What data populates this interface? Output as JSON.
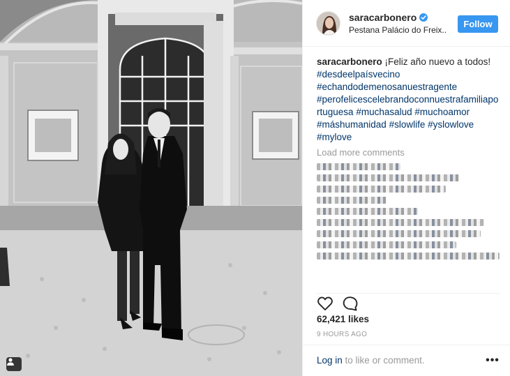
{
  "post": {
    "username": "saracarbonero",
    "location": "Pestana Palácio do Freix...",
    "follow_label": "Follow",
    "caption_user": "saracarbonero",
    "caption_text": " ¡Feliz año nuevo a todos!",
    "hashtags": [
      "#desdeelpaísvecino",
      "#echandodemenosanuestragente",
      "#perofelicescelebrandoconnuestrafamiliaportuguesa",
      "#muchasalud",
      "#muchoamor",
      "#máshumanidad",
      "#slowlife",
      "#yslowlove",
      "#mylove"
    ],
    "load_more": "Load more comments",
    "likes": "62,421 likes",
    "timestamp": "9 HOURS AGO",
    "login_link": "Log in",
    "login_rest": " to like or comment.",
    "more_label": "•••"
  },
  "icons": {
    "verified": "verified-badge-icon",
    "heart": "heart-icon",
    "comment": "comment-icon",
    "user_tag": "user-tag-icon"
  },
  "colors": {
    "follow": "#3897f0",
    "hashtag": "#003569",
    "muted": "#999999",
    "verified": "#3897f0"
  }
}
